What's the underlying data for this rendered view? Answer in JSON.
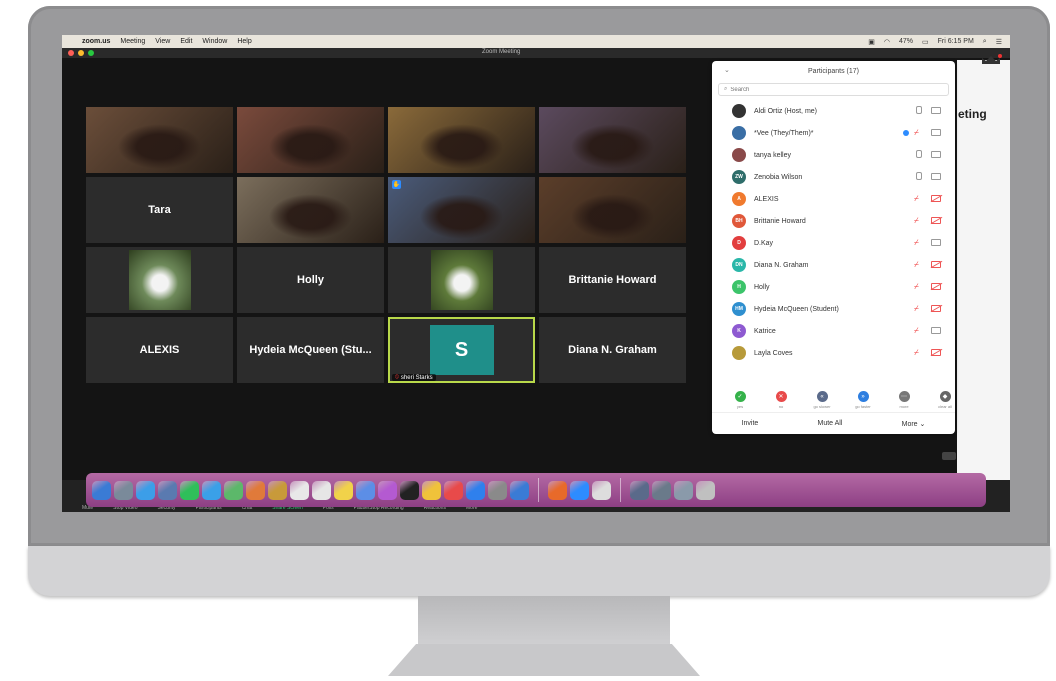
{
  "menubar": {
    "app": "zoom.us",
    "items": [
      "Meeting",
      "View",
      "Edit",
      "Window",
      "Help"
    ],
    "battery": "47%",
    "clock": "Fri 6:15 PM"
  },
  "window": {
    "title": "Zoom Meeting"
  },
  "behind": {
    "partial_text": "eting"
  },
  "gallery": {
    "tiles": [
      {
        "kind": "video",
        "bg": "#6b4e3a"
      },
      {
        "kind": "video",
        "bg": "#7a4a3c"
      },
      {
        "kind": "video",
        "bg": "#8a6a3a"
      },
      {
        "kind": "video",
        "bg": "#5b4a5e"
      },
      {
        "kind": "name",
        "name": "Tara"
      },
      {
        "kind": "video",
        "bg": "#7b6e5c"
      },
      {
        "kind": "video",
        "bg": "#4a5b7a",
        "hand": true
      },
      {
        "kind": "video",
        "bg": "#5b3e2a"
      },
      {
        "kind": "photo",
        "bg": "#6e8a5a"
      },
      {
        "kind": "name",
        "name": "Holly"
      },
      {
        "kind": "photo",
        "bg": "#5e7a3a"
      },
      {
        "kind": "name",
        "name": "Brittanie Howard"
      },
      {
        "kind": "name",
        "name": "ALEXIS"
      },
      {
        "kind": "name",
        "name": "Hydeia McQueen (Stu..."
      },
      {
        "kind": "avatar",
        "letter": "S",
        "chip": "sheri Starks",
        "active": true
      },
      {
        "kind": "name",
        "name": "Diana N. Graham"
      }
    ]
  },
  "participants": {
    "title": "Participants (17)",
    "search_placeholder": "Search",
    "list": [
      {
        "name": "Aldi Ortiz (Host, me)",
        "initials": "",
        "color": "#333333",
        "mic": "on",
        "cam": "on"
      },
      {
        "name": "*Vee (They/Them)*",
        "initials": "",
        "color": "#3a6ea5",
        "mic": "muted",
        "cam": "on",
        "hand": true
      },
      {
        "name": "tanya kelley",
        "initials": "",
        "color": "#8a4a4a",
        "mic": "on",
        "cam": "on"
      },
      {
        "name": "Zenobia Wilson",
        "initials": "ZW",
        "color": "#2e6d6a",
        "mic": "on",
        "cam": "on"
      },
      {
        "name": "ALEXIS",
        "initials": "A",
        "color": "#f07a2e",
        "mic": "muted",
        "cam": "off"
      },
      {
        "name": "Brittanie Howard",
        "initials": "BH",
        "color": "#e0583a",
        "mic": "muted",
        "cam": "off"
      },
      {
        "name": "D.Kay",
        "initials": "D",
        "color": "#e23e3e",
        "mic": "muted",
        "cam": "on"
      },
      {
        "name": "Diana N. Graham",
        "initials": "DN",
        "color": "#2ab7a9",
        "mic": "muted",
        "cam": "off"
      },
      {
        "name": "Holly",
        "initials": "H",
        "color": "#3cc46a",
        "mic": "muted",
        "cam": "off"
      },
      {
        "name": "Hydeia McQueen (Student)",
        "initials": "HM",
        "color": "#2f8fcf",
        "mic": "muted",
        "cam": "off"
      },
      {
        "name": "Katrice",
        "initials": "K",
        "color": "#8e5ad1",
        "mic": "muted",
        "cam": "on"
      },
      {
        "name": "Layla Coves",
        "initials": "",
        "color": "#b79a3a",
        "mic": "muted",
        "cam": "off"
      }
    ],
    "nonverbal": [
      {
        "label": "yes",
        "color": "#35b24a",
        "glyph": "✓"
      },
      {
        "label": "no",
        "color": "#e84a4a",
        "glyph": "✕"
      },
      {
        "label": "go slower",
        "color": "#5a6a8a",
        "glyph": "«"
      },
      {
        "label": "go faster",
        "color": "#2d7ee0",
        "glyph": "»"
      },
      {
        "label": "more",
        "color": "#777777",
        "glyph": "⋯"
      },
      {
        "label": "clear all",
        "color": "#666666",
        "glyph": "◆"
      }
    ],
    "footer": {
      "invite": "Invite",
      "mute_all": "Mute All",
      "more": "More ⌄"
    }
  },
  "toolbar": {
    "labels": [
      "Mute",
      "Stop Video",
      "Security",
      "Participants",
      "Chat",
      "Share Screen",
      "Polls",
      "Pause/Stop Recording",
      "Reactions",
      "More"
    ]
  },
  "dock": {
    "icons": [
      "#3a7bd5",
      "#7a8a9a",
      "#3c9ee8",
      "#5a7ab0",
      "#2fbf5a",
      "#3aa0e8",
      "#5cb86a",
      "#e07a3a",
      "#c89a3a",
      "#e8e8e8",
      "#e6e6e6",
      "#f1d24a",
      "#5c8ee6",
      "#b45ad1",
      "#222222",
      "#f0c23a",
      "#e84a4a",
      "#2f80ed",
      "#8a8a8a",
      "#3a7bd5",
      "#e86a2a",
      "#2d8cff",
      "#dddddd",
      "#5a6a8a",
      "#6a7a8a",
      "#8a9aaa",
      "#c0c0c0"
    ]
  }
}
